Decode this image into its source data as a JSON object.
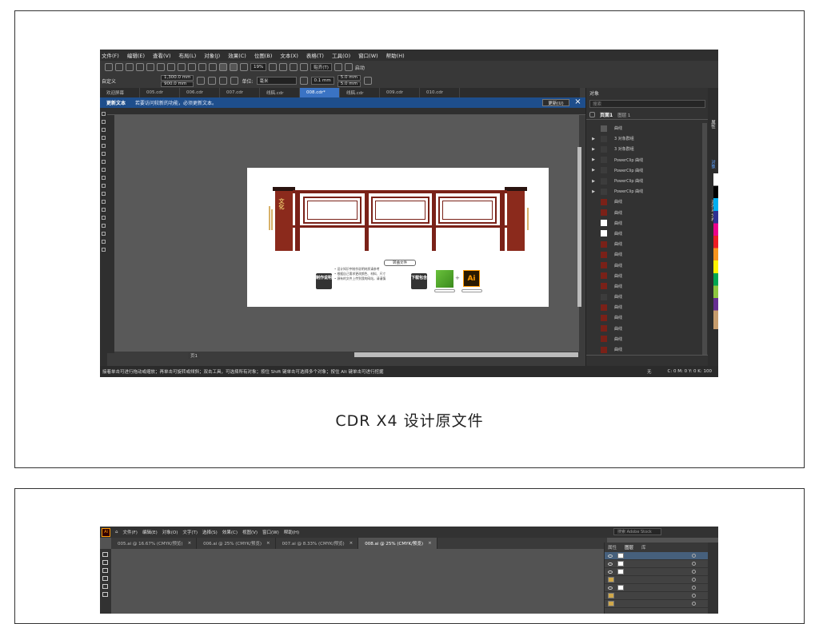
{
  "caption": "CDR X4 设计原文件",
  "cdr": {
    "menu": [
      "文件(F)",
      "编辑(E)",
      "查看(V)",
      "布局(L)",
      "对象(J)",
      "效果(C)",
      "位图(B)",
      "文本(X)",
      "表格(T)",
      "工具(O)",
      "窗口(W)",
      "帮助(H)"
    ],
    "zoom": "19%",
    "snap_label": "贴齐(T)",
    "launch_label": "启动",
    "custom_label": "自定义",
    "width": "1,300.0 mm",
    "height": "900.0 mm",
    "unit_label": "单位:",
    "unit": "毫米",
    "nudge": "0.1 mm",
    "dup_x": "5.0 mm",
    "dup_y": "5.0 mm",
    "tabs": [
      "欢迎屏幕",
      "005.cdr",
      "006.cdr",
      "007.cdr",
      "线稿.cdr",
      "008.cdr*",
      "线稿.cdr",
      "009.cdr",
      "010.cdr"
    ],
    "active_tab_index": 5,
    "update_title": "更新文本",
    "update_msg": "若要访问较新的功能，必须更新文本。",
    "update_btn": "更新(U)",
    "page_tab": "页1",
    "status_text": "接着单击可进行拖动或缩放；再单击可旋转或倾斜；双击工具，可选择所有对象；按住 Shift 键单击可选择多个对象；按住 Alt 键单击可进行挖掘",
    "fill_none": "无",
    "cmyk": "C: 0 M: 0 Y: 0 K: 100",
    "doc": {
      "file_label": "转曲文件",
      "badge_make": "制作说明",
      "badge_download": "下载包含",
      "bullets": [
        "• 设计知识中制作说明材质请参考",
        "• 根据自己需求更改颜色、材料、尺寸",
        "• 源有的文件上传到我的网站，请谨慎"
      ],
      "ai_logo": "Ai",
      "plus": "+",
      "sign_text": "文化"
    },
    "objects_panel": {
      "title": "对象",
      "search_placeholder": "搜索",
      "page": "页面1",
      "layer": "图层 1",
      "rows": [
        {
          "label": "曲线",
          "arrow": "",
          "color": "#5a5a5a"
        },
        {
          "label": "3 对象群组",
          "arrow": "▶",
          "color": "#3c3c3c"
        },
        {
          "label": "3 对象群组",
          "arrow": "▶",
          "color": "#3c3c3c"
        },
        {
          "label": "PowerClip 曲线",
          "arrow": "▶",
          "color": "#3c3c3c"
        },
        {
          "label": "PowerClip 曲线",
          "arrow": "▶",
          "color": "#3c3c3c"
        },
        {
          "label": "PowerClip 曲线",
          "arrow": "▶",
          "color": "#3c3c3c"
        },
        {
          "label": "PowerClip 曲线",
          "arrow": "▶",
          "color": "#3c3c3c"
        },
        {
          "label": "曲线",
          "arrow": "",
          "color": "#7a2118"
        },
        {
          "label": "曲线",
          "arrow": "",
          "color": "#7a2118"
        },
        {
          "label": "曲线",
          "arrow": "",
          "color": "#ffffff"
        },
        {
          "label": "曲线",
          "arrow": "",
          "color": "#ffffff"
        },
        {
          "label": "曲线",
          "arrow": "",
          "color": "#7a2118"
        },
        {
          "label": "曲线",
          "arrow": "",
          "color": "#7a2118"
        },
        {
          "label": "曲线",
          "arrow": "",
          "color": "#7a2118"
        },
        {
          "label": "曲线",
          "arrow": "",
          "color": "#7a2118"
        },
        {
          "label": "曲线",
          "arrow": "",
          "color": "#7a2118"
        },
        {
          "label": "曲线",
          "arrow": "",
          "color": "#3c3c3c"
        },
        {
          "label": "曲线",
          "arrow": "",
          "color": "#7a2118"
        },
        {
          "label": "曲线",
          "arrow": "",
          "color": "#7a2118"
        },
        {
          "label": "曲线",
          "arrow": "",
          "color": "#7a2118"
        },
        {
          "label": "曲线",
          "arrow": "",
          "color": "#7a2118"
        },
        {
          "label": "曲线",
          "arrow": "",
          "color": "#7a2118"
        }
      ]
    },
    "side_tabs": [
      "属性",
      "对象",
      "对齐与分布"
    ]
  },
  "ai": {
    "menu": [
      "文件(F)",
      "编辑(E)",
      "对象(O)",
      "文字(T)",
      "选择(S)",
      "效果(C)",
      "视图(V)",
      "窗口(W)",
      "帮助(H)"
    ],
    "search_placeholder": "搜索 Adobe Stock",
    "tabs": [
      {
        "label": "005.ai @ 16.67% (CMYK/预览)",
        "active": false
      },
      {
        "label": "006.ai @ 25% (CMYK/预览)",
        "active": false
      },
      {
        "label": "007.ai @ 8.33% (CMYK/预览)",
        "active": false
      },
      {
        "label": "008.ai @ 25% (CMYK/预览)",
        "active": true
      }
    ],
    "panel_tabs": [
      "属性",
      "图层",
      "库"
    ],
    "active_panel_tab": 1
  },
  "colors": {
    "brand_red": "#7a2118",
    "cdr_blue": "#1e4e8c",
    "ai_orange": "#ff9a00"
  }
}
